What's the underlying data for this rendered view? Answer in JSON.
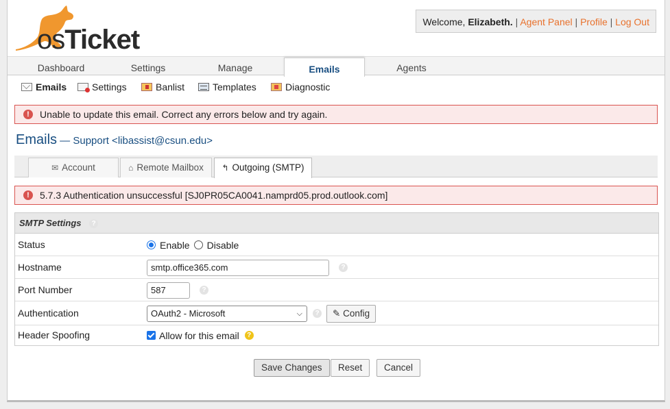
{
  "header": {
    "logo_text_os": "os",
    "logo_text_ticket": "Ticket",
    "welcome_prefix": "Welcome, ",
    "welcome_name": "Elizabeth.",
    "links": [
      "Agent Panel",
      "Profile",
      "Log Out"
    ],
    "separator": " | "
  },
  "nav": {
    "tabs": [
      "Dashboard",
      "Settings",
      "Manage",
      "Emails",
      "Agents"
    ],
    "active": "Emails"
  },
  "subnav": {
    "items": [
      {
        "label": "Emails",
        "icon": "envelope-icon"
      },
      {
        "label": "Settings",
        "icon": "email-settings-icon"
      },
      {
        "label": "Banlist",
        "icon": "banlist-icon"
      },
      {
        "label": "Templates",
        "icon": "templates-icon"
      },
      {
        "label": "Diagnostic",
        "icon": "diagnostic-icon"
      }
    ]
  },
  "errors": {
    "main": "Unable to update this email. Correct any errors below and try again.",
    "smtp": "5.7.3 Authentication unsuccessful [SJ0PR05CA0041.namprd05.prod.outlook.com]"
  },
  "page": {
    "title": "Emails",
    "subtitle": " — Support <libassist@csun.edu>"
  },
  "tabs": {
    "items": [
      "Account",
      "Remote Mailbox",
      "Outgoing (SMTP)"
    ],
    "active": "Outgoing (SMTP)"
  },
  "smtp": {
    "section_title": "SMTP Settings",
    "status_label": "Status",
    "status_enable": "Enable",
    "status_disable": "Disable",
    "hostname_label": "Hostname",
    "hostname_value": "smtp.office365.com",
    "port_label": "Port Number",
    "port_value": "587",
    "auth_label": "Authentication",
    "auth_value": "OAuth2 - Microsoft",
    "config_button": "Config",
    "spoof_label": "Header Spoofing",
    "spoof_checkbox": "Allow for this email"
  },
  "actions": {
    "save": "Save Changes",
    "reset": "Reset",
    "cancel": "Cancel"
  },
  "colors": {
    "link_orange": "#e8712c",
    "title_blue": "#184e81",
    "error_red": "#d9534f",
    "error_bg": "#fbe9e9"
  }
}
